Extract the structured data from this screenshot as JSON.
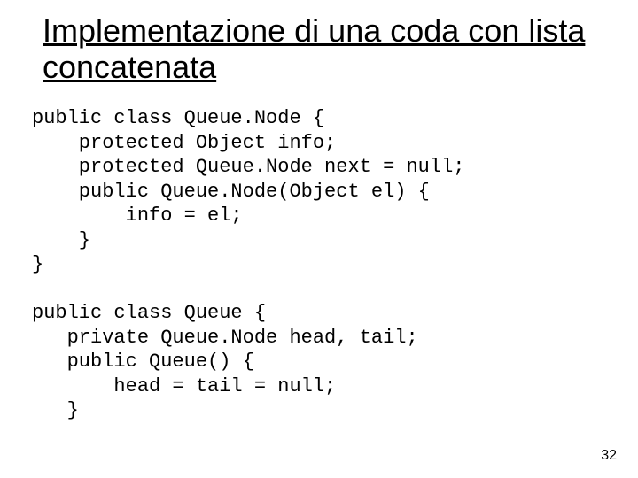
{
  "title": "Implementazione di una coda con lista concatenata",
  "code1": "public class Queue.Node {\n    protected Object info;\n    protected Queue.Node next = null;\n    public Queue.Node(Object el) {\n        info = el;\n    }\n}",
  "code2": "public class Queue {\n   private Queue.Node head, tail;\n   public Queue() {\n       head = tail = null;\n   }",
  "page_number": "32"
}
